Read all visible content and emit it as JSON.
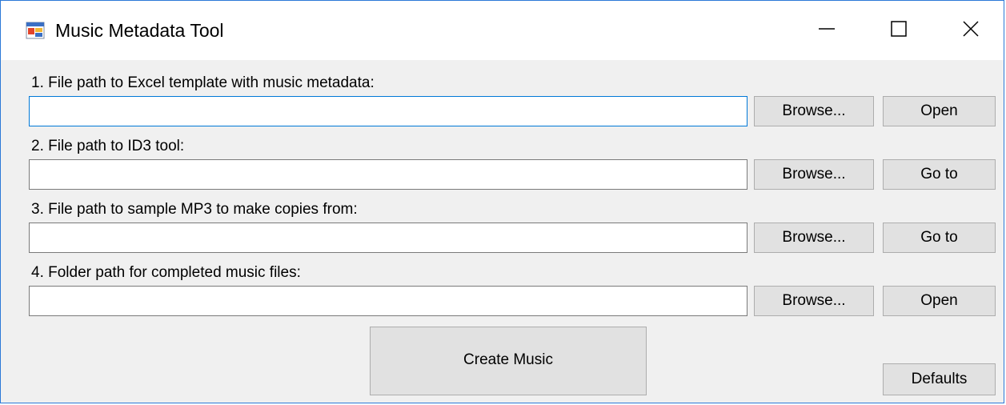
{
  "window": {
    "title": "Music Metadata Tool",
    "icons": {
      "app": "app-window-icon",
      "minimize": "minimize-icon",
      "maximize": "maximize-icon",
      "close": "close-icon"
    }
  },
  "rows": [
    {
      "label": "1. File path to Excel template with music metadata:",
      "value": "",
      "browse": "Browse...",
      "action": "Open"
    },
    {
      "label": "2. File path to ID3 tool:",
      "value": "",
      "browse": "Browse...",
      "action": "Go to"
    },
    {
      "label": "3. File path to sample MP3 to make copies from:",
      "value": "",
      "browse": "Browse...",
      "action": "Go to"
    },
    {
      "label": "4. Folder path for completed music files:",
      "value": "",
      "browse": "Browse...",
      "action": "Open"
    }
  ],
  "buttons": {
    "create": "Create Music",
    "defaults": "Defaults"
  },
  "colors": {
    "window_border": "#2b79d7",
    "focus_border": "#0078d7",
    "button_face": "#e1e1e1",
    "client_bg": "#f0f0f0"
  }
}
